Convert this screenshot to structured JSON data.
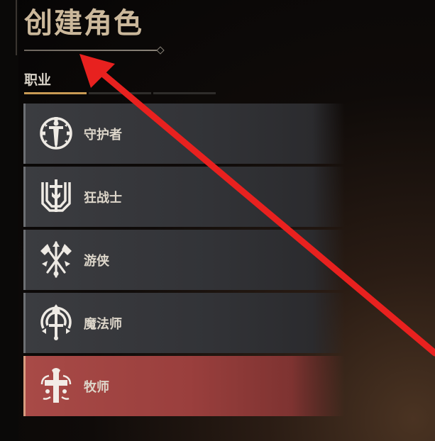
{
  "header": {
    "title": "创建角色"
  },
  "tabs": {
    "active_label": "职业"
  },
  "classes": [
    {
      "name": "守护者",
      "icon": "guardian-shield-sword-icon",
      "selected": false
    },
    {
      "name": "狂战士",
      "icon": "berserker-crest-icon",
      "selected": false
    },
    {
      "name": "游侠",
      "icon": "ranger-crossed-axes-icon",
      "selected": false
    },
    {
      "name": "魔法师",
      "icon": "mage-staff-icon",
      "selected": false
    },
    {
      "name": "牧师",
      "icon": "priest-cross-icon",
      "selected": true
    }
  ],
  "colors": {
    "accent": "#c89a54",
    "selected_card": "#a84a47",
    "annotation_arrow": "#e8211f"
  }
}
